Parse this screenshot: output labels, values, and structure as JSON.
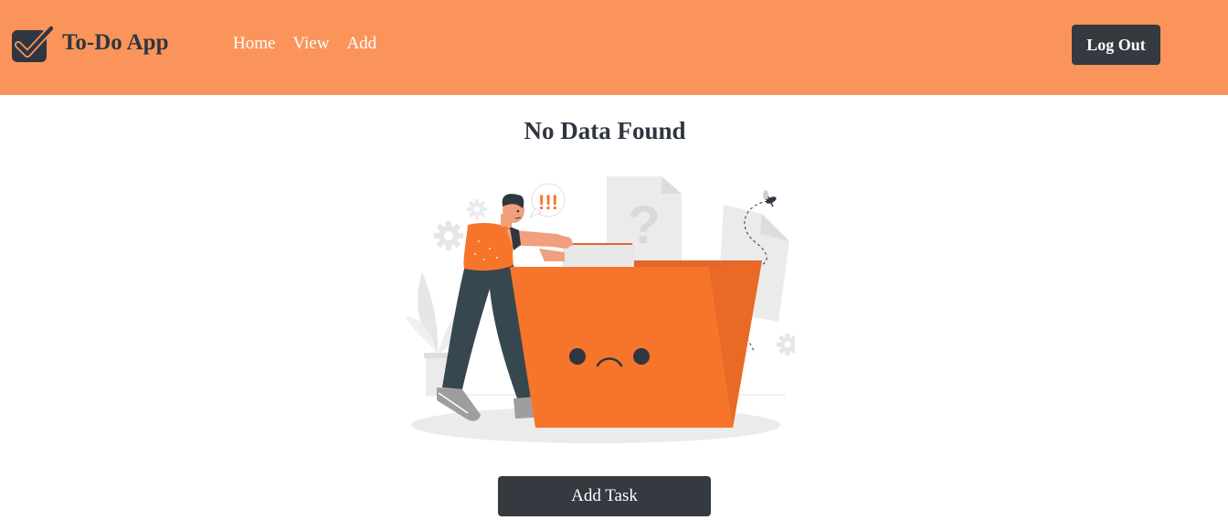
{
  "app": {
    "title": "To-Do App"
  },
  "nav": {
    "links": [
      {
        "label": "Home"
      },
      {
        "label": "View"
      },
      {
        "label": "Add"
      }
    ],
    "logout_label": "Log Out"
  },
  "main": {
    "heading": "No Data Found",
    "speech_bubble_text": "!!!",
    "question_mark": "?",
    "add_task_label": "Add Task"
  },
  "colors": {
    "navbar_bg": "#fb945b",
    "button_dark": "#343a40",
    "folder_orange": "#f7752b",
    "folder_orange_dark": "#e0682a",
    "text_dark": "#2f3640"
  },
  "icons": {
    "brand": "checkbox-check-icon",
    "gears": "gear-icon"
  }
}
